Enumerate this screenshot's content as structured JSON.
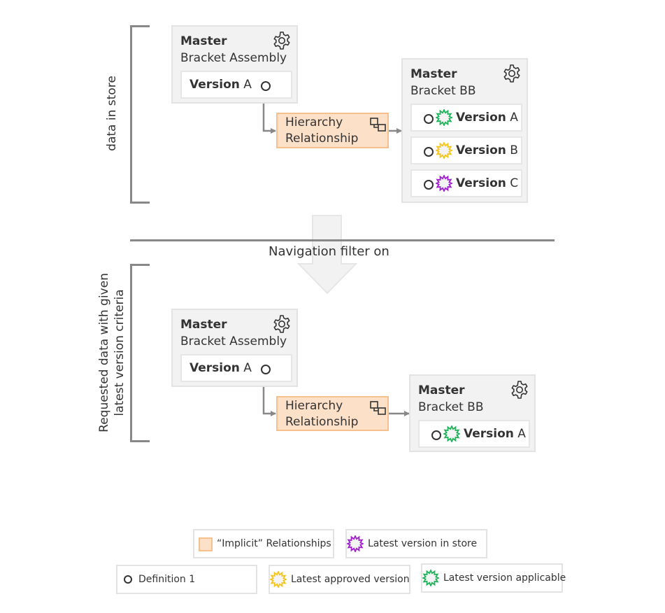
{
  "colors": {
    "master_bg": "#f2f2f2",
    "relationship_fill": "#fde0c8",
    "relationship_border": "#f6c08d",
    "latest_in_store": "#a020d0",
    "latest_approved": "#f5c518",
    "latest_applicable": "#1fb35a",
    "connector": "#888888"
  },
  "top_section": {
    "label": "data in store",
    "left_master": {
      "title": "Master",
      "name": "Bracket Assembly",
      "icon": "gear-icon",
      "versions": [
        {
          "label": "Version",
          "letter": "A",
          "icon": "definition-circle-icon"
        }
      ]
    },
    "relationship": {
      "line1": "Hierarchy",
      "line2": "Relationship",
      "icon": "relationship-icon"
    },
    "right_master": {
      "title": "Master",
      "name": "Bracket BB",
      "icon": "gear-icon",
      "versions": [
        {
          "label": "Version",
          "letter": "A",
          "badge": "latest-version-applicable"
        },
        {
          "label": "Version",
          "letter": "B",
          "badge": "latest-approved-version"
        },
        {
          "label": "Version",
          "letter": "C",
          "badge": "latest-version-in-store"
        }
      ]
    }
  },
  "filter": {
    "label": "Navigation filter on",
    "icon": "down-arrow-icon"
  },
  "bottom_section": {
    "label_line1": "Requested data with given",
    "label_line2": "latest version criteria",
    "left_master": {
      "title": "Master",
      "name": "Bracket Assembly",
      "icon": "gear-icon",
      "versions": [
        {
          "label": "Version",
          "letter": "A",
          "icon": "definition-circle-icon"
        }
      ]
    },
    "relationship": {
      "line1": "Hierarchy",
      "line2": "Relationship",
      "icon": "relationship-icon"
    },
    "right_master": {
      "title": "Master",
      "name": "Bracket BB",
      "icon": "gear-icon",
      "versions": [
        {
          "label": "Version",
          "letter": "A",
          "badge": "latest-version-applicable"
        }
      ]
    }
  },
  "legend": {
    "implicit": "“Implicit” Relationships",
    "latest_in_store": "Latest version in store",
    "definition": "Definition 1",
    "latest_approved": "Latest approved version",
    "latest_applicable": "Latest version applicable"
  }
}
